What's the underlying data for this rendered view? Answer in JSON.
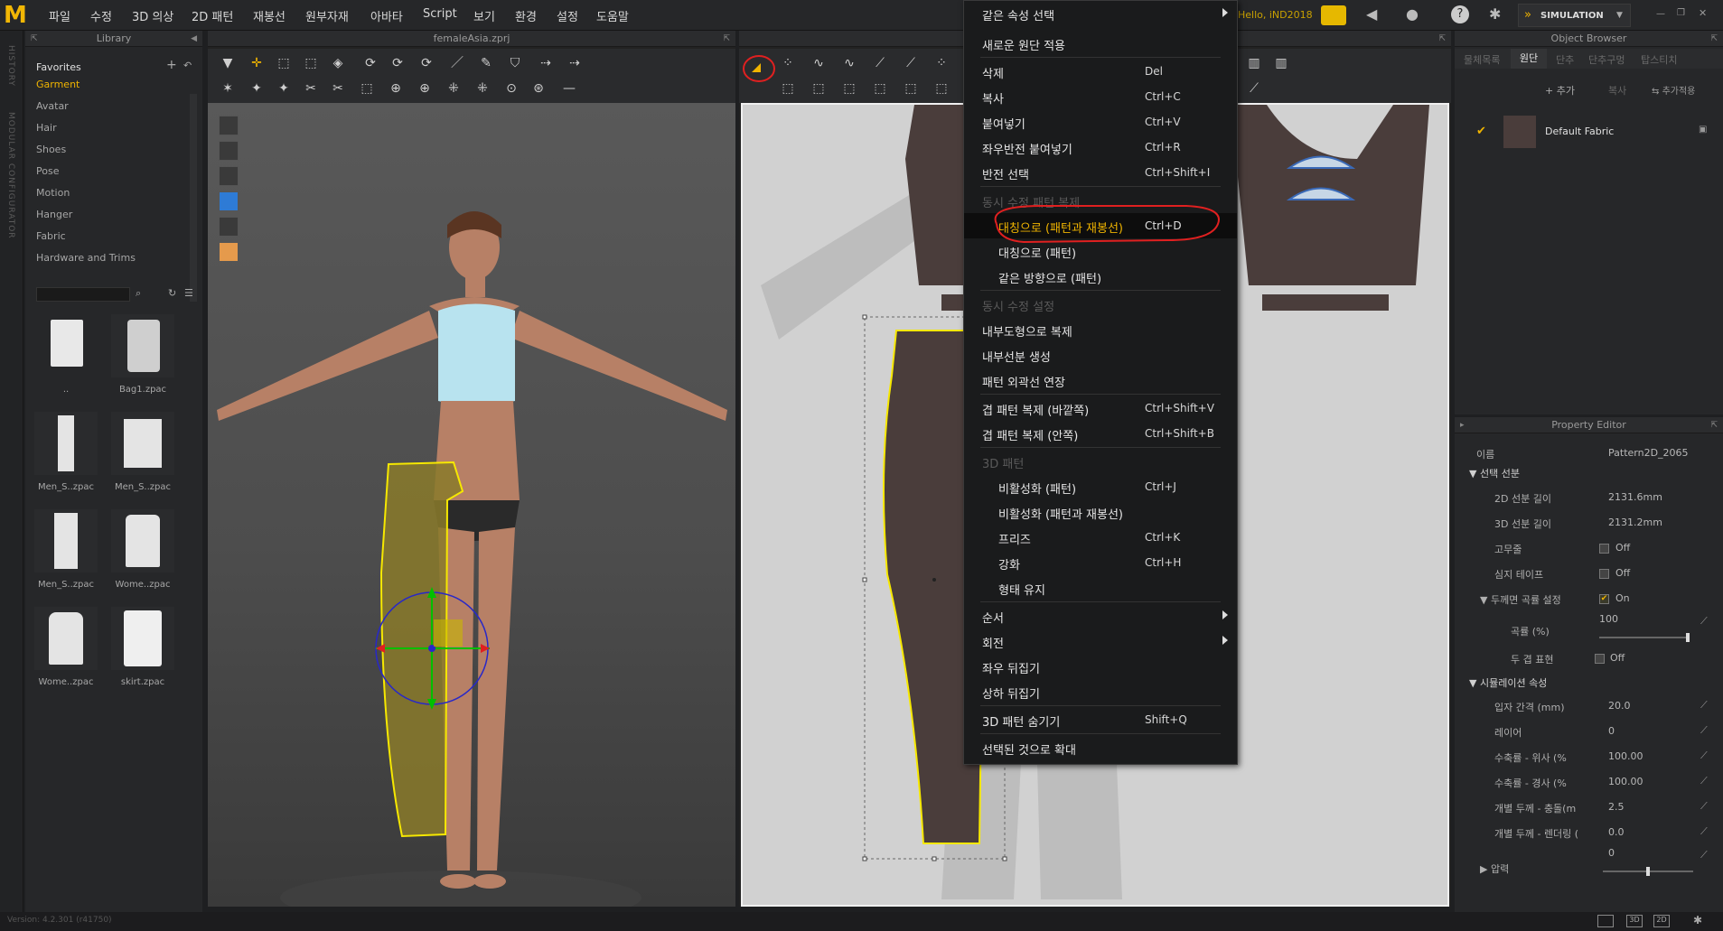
{
  "app": {
    "logo": "M",
    "file_name": "femaleAsia.zprj",
    "version": "Version: 4.2.301 (r41750)"
  },
  "menu": [
    "파일",
    "수정",
    "3D 의상",
    "2D 패턴",
    "재봉선",
    "원부자재",
    "아바타",
    "Script",
    "보기",
    "환경",
    "설정",
    "도움말"
  ],
  "topright": {
    "user": "Hello, iND2018",
    "simulation": "SIMULATION"
  },
  "left_strip": {
    "history": "HISTORY",
    "modular": "MODULAR CONFIGURATOR"
  },
  "library": {
    "title": "Library",
    "categories": [
      "Favorites",
      "Garment",
      "Avatar",
      "Hair",
      "Shoes",
      "Pose",
      "Motion",
      "Hanger",
      "Fabric",
      "Hardware and Trims"
    ],
    "search_placeholder": "",
    "items": [
      "..",
      "Bag1.zpac",
      "Men_S..zpac",
      "Men_S..zpac",
      "Men_S..zpac",
      "Wome..zpac",
      "Wome..zpac",
      "skirt.zpac"
    ]
  },
  "object_browser": {
    "title": "Object Browser",
    "tabs": [
      "물체목록",
      "원단",
      "단추",
      "단추구멍",
      "탑스티치"
    ],
    "add_label": "+ 추가",
    "copy_label": "복사",
    "add_more_label": "추가적용",
    "fabric_name": "Default Fabric"
  },
  "property_editor": {
    "title": "Property Editor",
    "name_label": "이름",
    "name_value": "Pattern2D_2065",
    "section1": "선택 선분",
    "rows1": [
      {
        "label": "2D 선분 길이",
        "value": "2131.6mm"
      },
      {
        "label": "3D 선분 길이",
        "value": "2131.2mm"
      },
      {
        "label": "고무줄",
        "value": "Off"
      },
      {
        "label": "심지 테이프",
        "value": "Off"
      },
      {
        "label": "두께면 곡률 설정",
        "value": "On"
      },
      {
        "label": "곡률 (%)",
        "value": "100"
      },
      {
        "label": "두 겹 표현",
        "value": "Off"
      }
    ],
    "section2": "시뮬레이션 속성",
    "rows2": [
      {
        "label": "입자 간격 (mm)",
        "value": "20.0"
      },
      {
        "label": "레이어",
        "value": "0"
      },
      {
        "label": "수축률 - 위사 (%",
        "value": "100.00"
      },
      {
        "label": "수축률 - 경사 (%",
        "value": "100.00"
      },
      {
        "label": "개별 두께 - 충돌(m",
        "value": "2.5"
      },
      {
        "label": "개별 두께 - 렌더링 (",
        "value": "0.0"
      },
      {
        "label": "압력",
        "value": "0"
      }
    ],
    "curvature_fraction": 1.0,
    "pressure_fraction": 0.5
  },
  "context_menu": {
    "items": [
      {
        "label": "같은 속성 선택",
        "shortcut": "",
        "type": "submenu"
      },
      {
        "label": "새로운 원단 적용",
        "shortcut": "",
        "type": "normal"
      },
      {
        "label": "삭제",
        "shortcut": "Del",
        "type": "normal"
      },
      {
        "label": "복사",
        "shortcut": "Ctrl+C",
        "type": "normal"
      },
      {
        "label": "붙여넣기",
        "shortcut": "Ctrl+V",
        "type": "normal"
      },
      {
        "label": "좌우반전 붙여넣기",
        "shortcut": "Ctrl+R",
        "type": "normal"
      },
      {
        "label": "반전 선택",
        "shortcut": "Ctrl+Shift+I",
        "type": "normal"
      },
      {
        "label": "동시 수정 패턴 복제",
        "shortcut": "",
        "type": "disabled"
      },
      {
        "label": "대칭으로 (패턴과 재봉선)",
        "shortcut": "Ctrl+D",
        "type": "highlighted"
      },
      {
        "label": "대칭으로 (패턴)",
        "shortcut": "",
        "type": "sub"
      },
      {
        "label": "같은 방향으로 (패턴)",
        "shortcut": "",
        "type": "sub"
      },
      {
        "label": "동시 수정 설정",
        "shortcut": "",
        "type": "disabled"
      },
      {
        "label": "내부도형으로 복제",
        "shortcut": "",
        "type": "normal"
      },
      {
        "label": "내부선분 생성",
        "shortcut": "",
        "type": "normal"
      },
      {
        "label": "패턴 외곽선 연장",
        "shortcut": "",
        "type": "normal"
      },
      {
        "label": "겹 패턴 복제 (바깥쪽)",
        "shortcut": "Ctrl+Shift+V",
        "type": "normal"
      },
      {
        "label": "겹 패턴 복제 (안쪽)",
        "shortcut": "Ctrl+Shift+B",
        "type": "normal"
      },
      {
        "label": "3D 패턴",
        "shortcut": "",
        "type": "disabled"
      },
      {
        "label": "비활성화 (패턴)",
        "shortcut": "Ctrl+J",
        "type": "sub"
      },
      {
        "label": "비활성화 (패턴과 재봉선)",
        "shortcut": "",
        "type": "sub"
      },
      {
        "label": "프리즈",
        "shortcut": "Ctrl+K",
        "type": "sub"
      },
      {
        "label": "강화",
        "shortcut": "Ctrl+H",
        "type": "sub"
      },
      {
        "label": "형태 유지",
        "shortcut": "",
        "type": "sub"
      },
      {
        "label": "순서",
        "shortcut": "",
        "type": "submenu"
      },
      {
        "label": "회전",
        "shortcut": "",
        "type": "submenu"
      },
      {
        "label": "좌우 뒤집기",
        "shortcut": "",
        "type": "normal"
      },
      {
        "label": "상하 뒤집기",
        "shortcut": "",
        "type": "normal"
      },
      {
        "label": "3D 패턴 숨기기",
        "shortcut": "Shift+Q",
        "type": "normal"
      },
      {
        "label": "선택된 것으로 확대",
        "shortcut": "",
        "type": "normal"
      }
    ]
  },
  "colors": {
    "accent": "#f0b400",
    "annotation_red": "#e02020",
    "pattern_fill": "#8a7a2a",
    "fabric_dark": "#4a3d3b"
  }
}
